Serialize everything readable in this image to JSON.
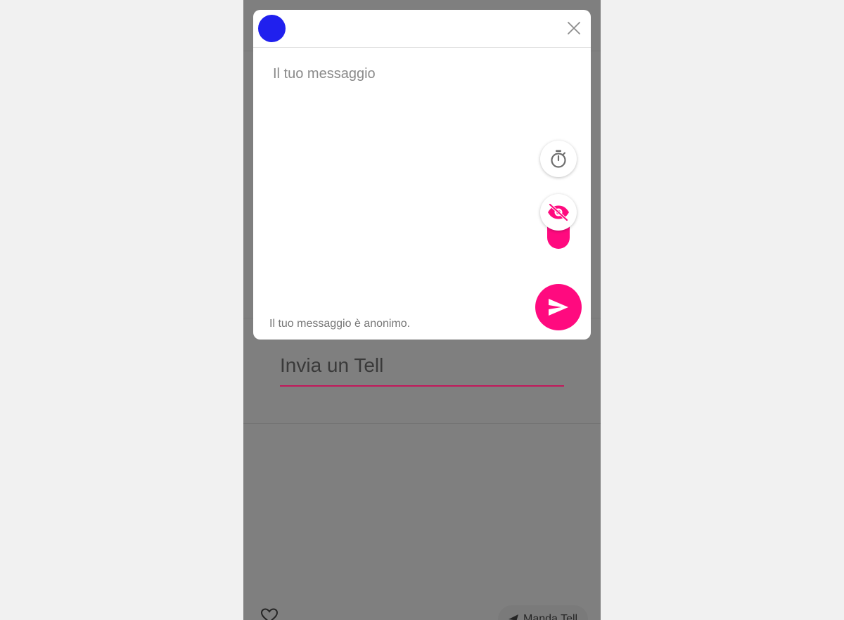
{
  "background": {
    "invia_field_text": "Invia un Tell",
    "manda_button_label": "Manda Tell"
  },
  "modal": {
    "message_placeholder": "Il tuo messaggio",
    "anonymous_note": "Il tuo messaggio è anonimo.",
    "avatar_color": "#2020ee",
    "accent_color": "#ff0a7f",
    "icons": {
      "close": "close-icon",
      "timer": "stopwatch-icon",
      "visibility": "eye-off-icon",
      "send": "send-icon"
    }
  }
}
